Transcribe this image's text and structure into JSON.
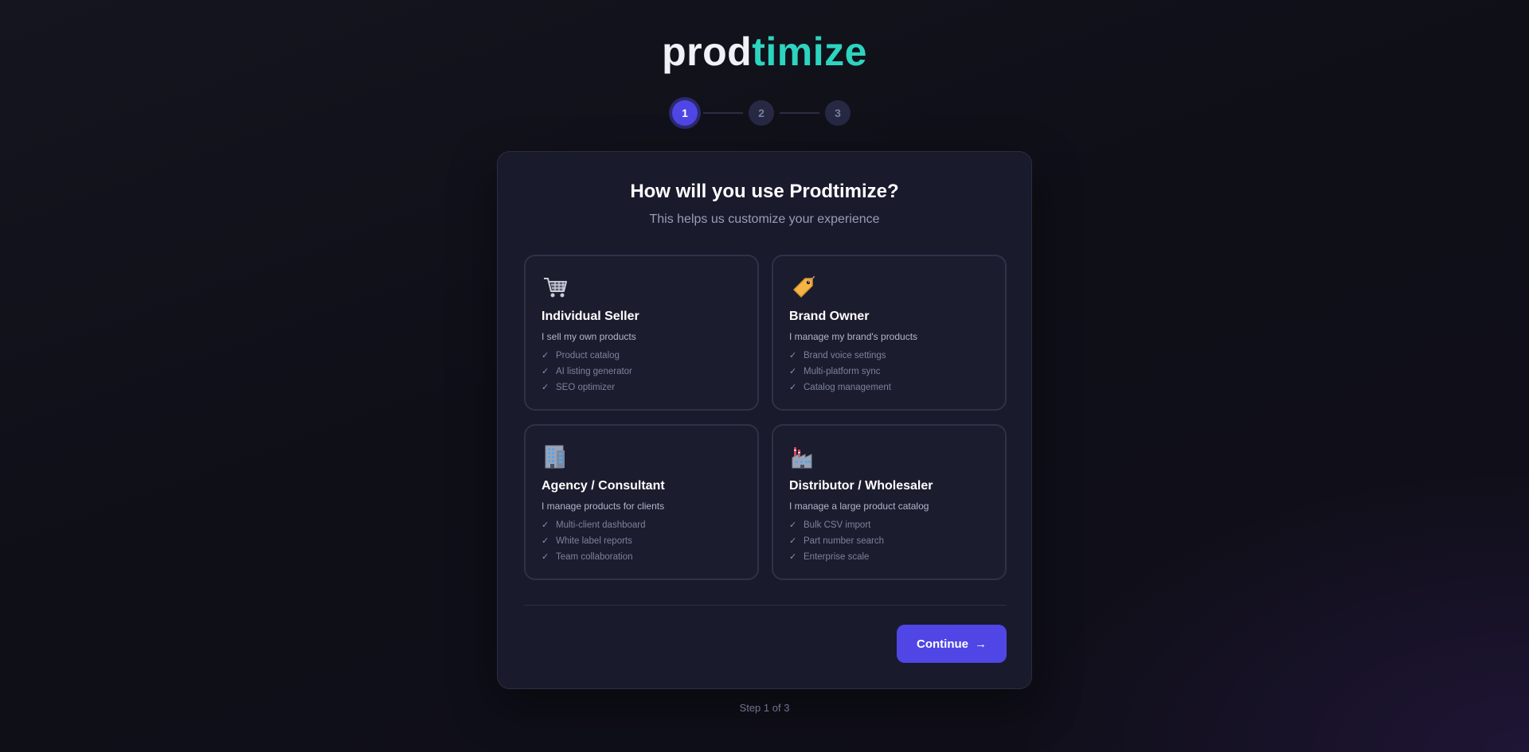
{
  "logo": {
    "part1": "prod",
    "part2": "timize"
  },
  "stepper": {
    "steps": [
      "1",
      "2",
      "3"
    ],
    "current": 1
  },
  "card": {
    "title": "How will you use Prodtimize?",
    "subtitle": "This helps us customize your experience"
  },
  "options": [
    {
      "icon": "shopping-cart-icon",
      "title": "Individual Seller",
      "description": "I sell my own products",
      "features": [
        "Product catalog",
        "AI listing generator",
        "SEO optimizer"
      ]
    },
    {
      "icon": "price-tag-icon",
      "title": "Brand Owner",
      "description": "I manage my brand's products",
      "features": [
        "Brand voice settings",
        "Multi-platform sync",
        "Catalog management"
      ]
    },
    {
      "icon": "office-building-icon",
      "title": "Agency / Consultant",
      "description": "I manage products for clients",
      "features": [
        "Multi-client dashboard",
        "White label reports",
        "Team collaboration"
      ]
    },
    {
      "icon": "factory-icon",
      "title": "Distributor / Wholesaler",
      "description": "I manage a large product catalog",
      "features": [
        "Bulk CSV import",
        "Part number search",
        "Enterprise scale"
      ]
    }
  ],
  "actions": {
    "continue_label": "Continue",
    "continue_icon": "arrow-right-icon"
  },
  "footer": {
    "step_text": "Step 1 of 3"
  },
  "colors": {
    "accent": "#4f46e5",
    "brand_teal": "#2dd4bf",
    "card_bg": "#191a2b",
    "page_bg": "#12121b"
  }
}
